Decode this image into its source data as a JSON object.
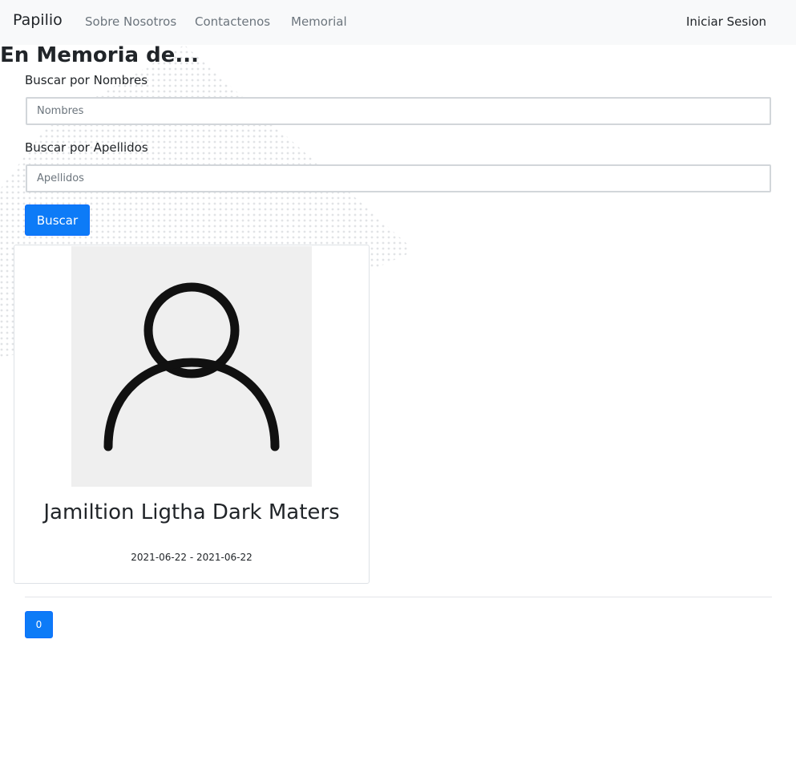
{
  "navbar": {
    "brand": "Papilio",
    "links": [
      {
        "label": "Sobre Nosotros"
      },
      {
        "label": "Contactenos"
      },
      {
        "label": "Memorial"
      }
    ],
    "login_label": "Iniciar Sesion"
  },
  "page": {
    "title": "En Memoria de..."
  },
  "search": {
    "first_name_label": "Buscar por Nombres",
    "first_name_placeholder": "Nombres",
    "first_name_value": "",
    "last_name_label": "Buscar por Apellidos",
    "last_name_placeholder": "Apellidos",
    "last_name_value": "",
    "button_label": "Buscar"
  },
  "memorials": [
    {
      "name": "Jamiltion Ligtha Dark Maters",
      "dates": "2021-06-22 - 2021-06-22",
      "avatar_icon": "user-placeholder-icon"
    }
  ],
  "pagination": {
    "pages": [
      "0"
    ],
    "active_page": "0"
  },
  "colors": {
    "primary": "#0d7bf7",
    "navbar_bg": "#f8f9fa",
    "nav_link": "#6c757d",
    "avatar_bg": "#efefef",
    "dots": "#e1e3e6"
  }
}
